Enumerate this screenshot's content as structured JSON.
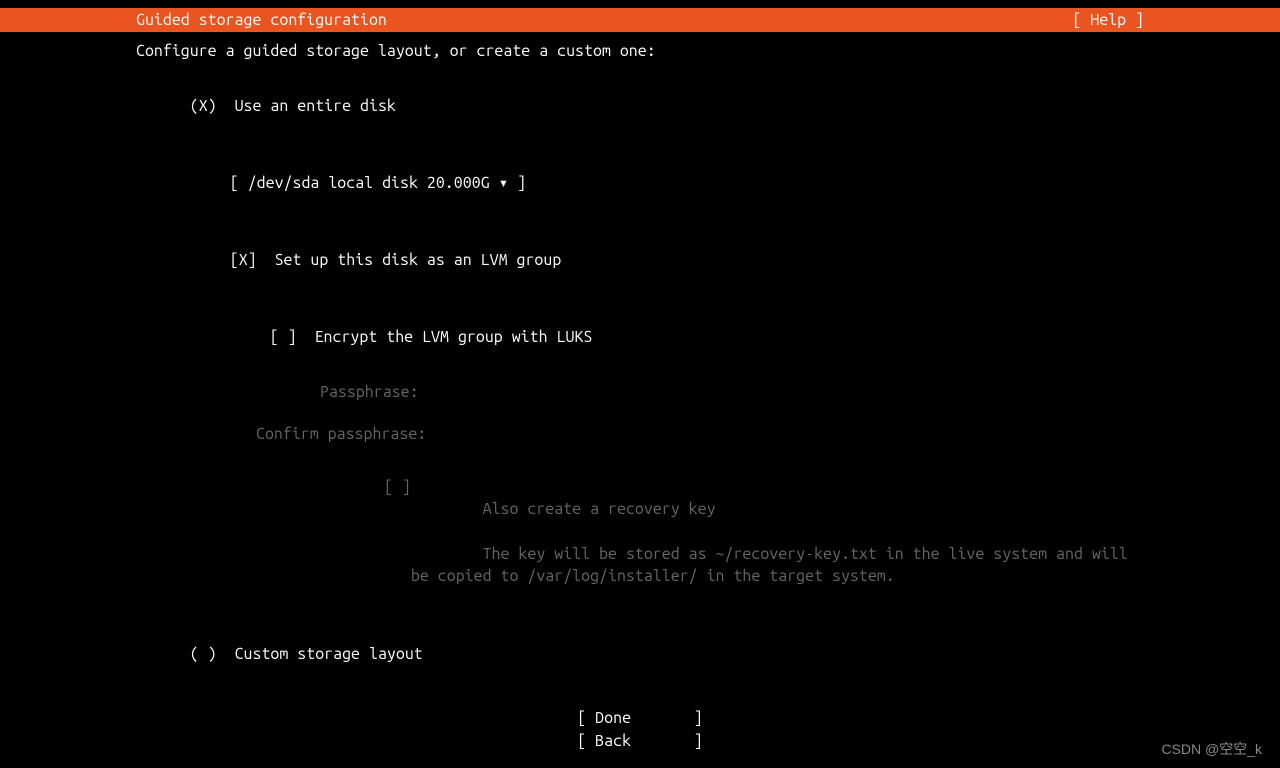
{
  "header": {
    "title": "Guided storage configuration",
    "help": "[ Help ]"
  },
  "intro": "Configure a guided storage layout, or create a custom one:",
  "option_entire_disk": {
    "marker": "(X)",
    "label": "Use an entire disk"
  },
  "disk_select": {
    "open": "[ ",
    "value": "/dev/sda local disk 20.000G",
    "arrow": "▾",
    "close": " ]"
  },
  "lvm": {
    "marker": "[X]",
    "label": "Set up this disk as an LVM group"
  },
  "encrypt": {
    "marker": "[ ]",
    "label": "Encrypt the LVM group with LUKS"
  },
  "passphrase_label": "Passphrase:",
  "confirm_label": "Confirm passphrase:",
  "recovery": {
    "marker": "[ ]",
    "title": "Also create a recovery key",
    "desc": "The key will be stored as ~/recovery-key.txt in the live system and will be copied to /var/log/installer/ in the target system."
  },
  "option_custom": {
    "marker": "( )",
    "label": "Custom storage layout"
  },
  "footer": {
    "done": "[ Done       ]",
    "back": "[ Back       ]"
  },
  "watermark": "CSDN @空空_k"
}
